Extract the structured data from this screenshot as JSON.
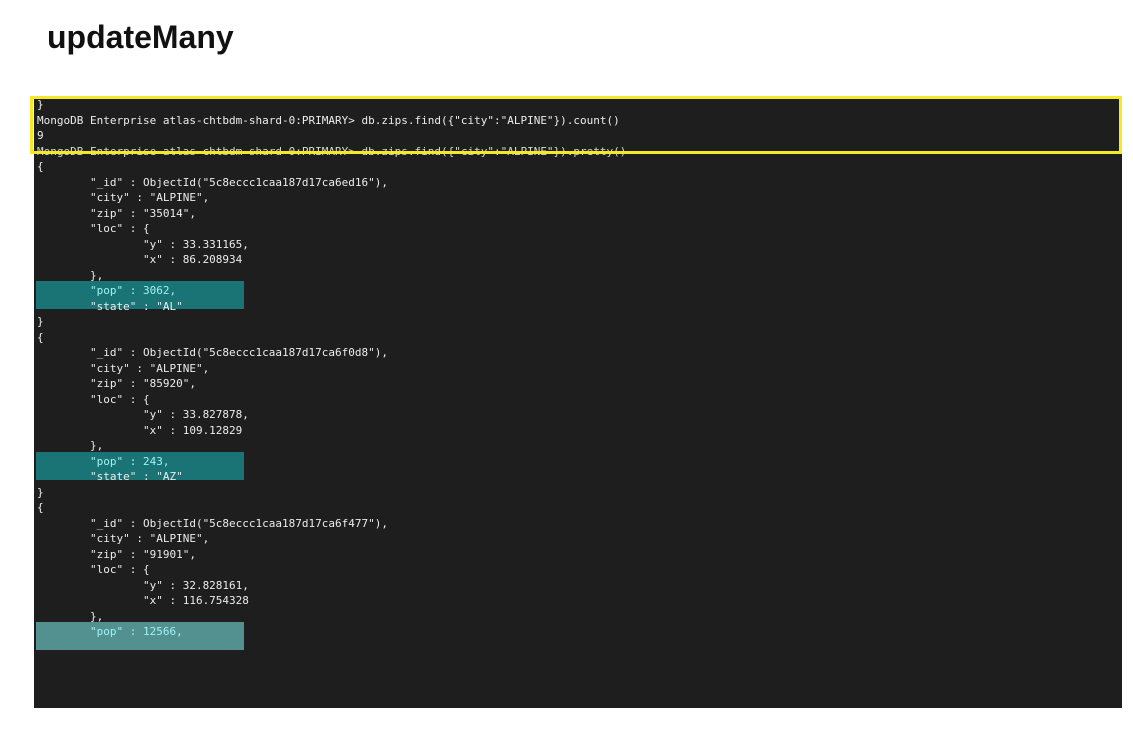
{
  "slide": {
    "title": "updateMany"
  },
  "terminal": {
    "lines": [
      "}",
      "MongoDB Enterprise atlas-chtbdm-shard-0:PRIMARY> db.zips.find({\"city\":\"ALPINE\"}).count()",
      "9",
      "MongoDB Enterprise atlas-chtbdm-shard-0:PRIMARY> db.zips.find({\"city\":\"ALPINE\"}).pretty()",
      "{",
      "        \"_id\" : ObjectId(\"5c8eccc1caa187d17ca6ed16\"),",
      "        \"city\" : \"ALPINE\",",
      "        \"zip\" : \"35014\",",
      "        \"loc\" : {",
      "                \"y\" : 33.331165,",
      "                \"x\" : 86.208934",
      "        },",
      "        \"pop\" : 3062,",
      "        \"state\" : \"AL\"",
      "}",
      "{",
      "        \"_id\" : ObjectId(\"5c8eccc1caa187d17ca6f0d8\"),",
      "        \"city\" : \"ALPINE\",",
      "        \"zip\" : \"85920\",",
      "        \"loc\" : {",
      "                \"y\" : 33.827878,",
      "                \"x\" : 109.12829",
      "        },",
      "        \"pop\" : 243,",
      "        \"state\" : \"AZ\"",
      "}",
      "{",
      "        \"_id\" : ObjectId(\"5c8eccc1caa187d17ca6f477\"),",
      "        \"city\" : \"ALPINE\",",
      "        \"zip\" : \"91901\",",
      "        \"loc\" : {",
      "                \"y\" : 32.828161,",
      "                \"x\" : 116.754328",
      "        },",
      "        \"pop\" : 12566,"
    ],
    "highlighted_line_indices": [
      12,
      23,
      34
    ],
    "emphasized_line_indices": [
      0,
      1,
      2
    ]
  },
  "colors": {
    "terminal_background": "#1e1e1e",
    "terminal_text": "#ececec",
    "pop_highlight": "#1a7476",
    "pop_highlight_text": "#9ff3f0",
    "callout_border": "#f5e829"
  }
}
